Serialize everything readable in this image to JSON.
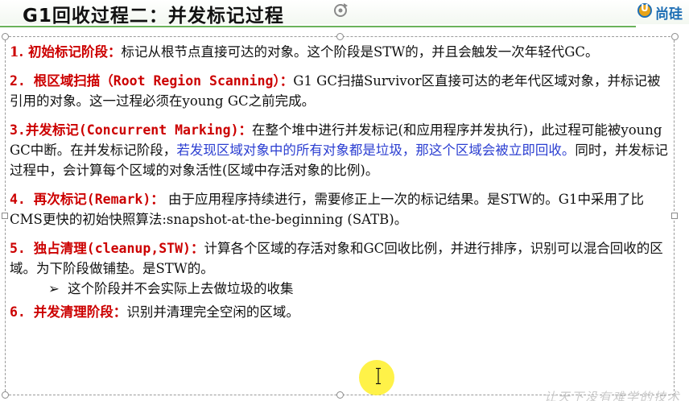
{
  "title": "G1回收过程二：并发标记过程",
  "logo": {
    "text": "尚硅",
    "mark": "U"
  },
  "watermark": "让天下没有难学的技术",
  "items": [
    {
      "label": "1. 初始标记阶段：",
      "text": "标记从根节点直接可达的对象。这个阶段是STW的，并且会触发一次年轻代GC。"
    },
    {
      "label": "2. 根区域扫描（Root Region Scanning）：",
      "text": "G1 GC扫描Survivor区直接可达的老年代区域对象，并标记被引用的对象。这一过程必须在young GC之前完成。"
    },
    {
      "label": "3.并发标记(Concurrent Marking)：",
      "text_a": "在整个堆中进行并发标记(和应用程序并发执行)，此过程可能被young GC中断。在并发标记阶段，",
      "text_blue": "若发现区域对象中的所有对象都是垃圾，那这个区域会被立即回收。",
      "text_b": "同时，并发标记过程中，会计算每个区域的对象活性(区域中存活对象的比例)。"
    },
    {
      "label": "4. 再次标记(Remark)：",
      "text": " 由于应用程序持续进行，需要修正上一次的标记结果。是STW的。G1中采用了比CMS更快的初始快照算法:snapshot-at-the-beginning (SATB)。"
    },
    {
      "label": "5. 独占清理(cleanup,STW)：",
      "text": "计算各个区域的存活对象和GC回收比例，并进行排序，识别可以混合回收的区域。为下阶段做铺垫。是STW的。",
      "bullet_mark": "➢",
      "bullet": "这个阶段并不会实际上去做垃圾的收集"
    },
    {
      "label": "6. 并发清理阶段：",
      "text": "识别并清理完全空闲的区域。"
    }
  ],
  "colors": {
    "label": "#cc0000",
    "highlight": "#2b3ed1",
    "title_underline": "#6bb35a",
    "cursor_highlight": "#fff028"
  }
}
